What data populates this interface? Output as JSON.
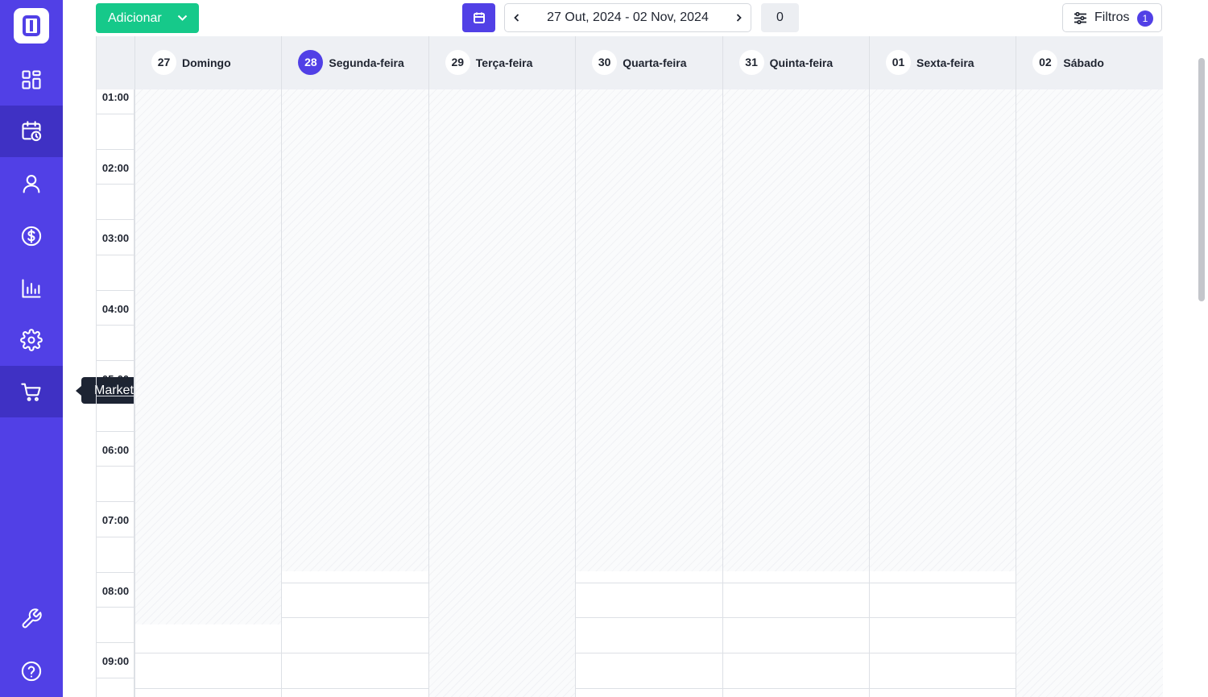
{
  "sidebar": {
    "items": [
      {
        "icon": "dashboard-icon"
      },
      {
        "icon": "calendar-clock-icon"
      },
      {
        "icon": "user-icon"
      },
      {
        "icon": "dollar-icon"
      },
      {
        "icon": "bar-chart-icon"
      },
      {
        "icon": "gear-icon"
      },
      {
        "icon": "cart-icon",
        "tooltip": "Marketplace"
      },
      {
        "icon": "wrench-icon"
      },
      {
        "icon": "help-icon"
      }
    ],
    "active_items": [
      "calendar-clock-icon",
      "cart-icon"
    ]
  },
  "tooltip": {
    "text": "Marketplace"
  },
  "toolbar": {
    "add_label": "Adicionar",
    "date_range": "27 Out, 2024 - 02 Nov, 2024",
    "count": "0",
    "filter_label": "Filtros",
    "filter_count": "1"
  },
  "calendar": {
    "days": [
      {
        "num": "27",
        "name": "Domingo",
        "today": false
      },
      {
        "num": "28",
        "name": "Segunda-feira",
        "today": true
      },
      {
        "num": "29",
        "name": "Terça-feira",
        "today": false
      },
      {
        "num": "30",
        "name": "Quarta-feira",
        "today": false
      },
      {
        "num": "31",
        "name": "Quinta-feira",
        "today": false
      },
      {
        "num": "01",
        "name": "Sexta-feira",
        "today": false
      },
      {
        "num": "02",
        "name": "Sábado",
        "today": false
      }
    ],
    "hours": [
      "01:00",
      "02:00",
      "03:00",
      "04:00",
      "05:00",
      "06:00",
      "07:00",
      "08:00",
      "09:00"
    ]
  },
  "colors": {
    "sidebar": "#5140e6",
    "accent": "#5140e6",
    "add_button": "#16c98a"
  }
}
